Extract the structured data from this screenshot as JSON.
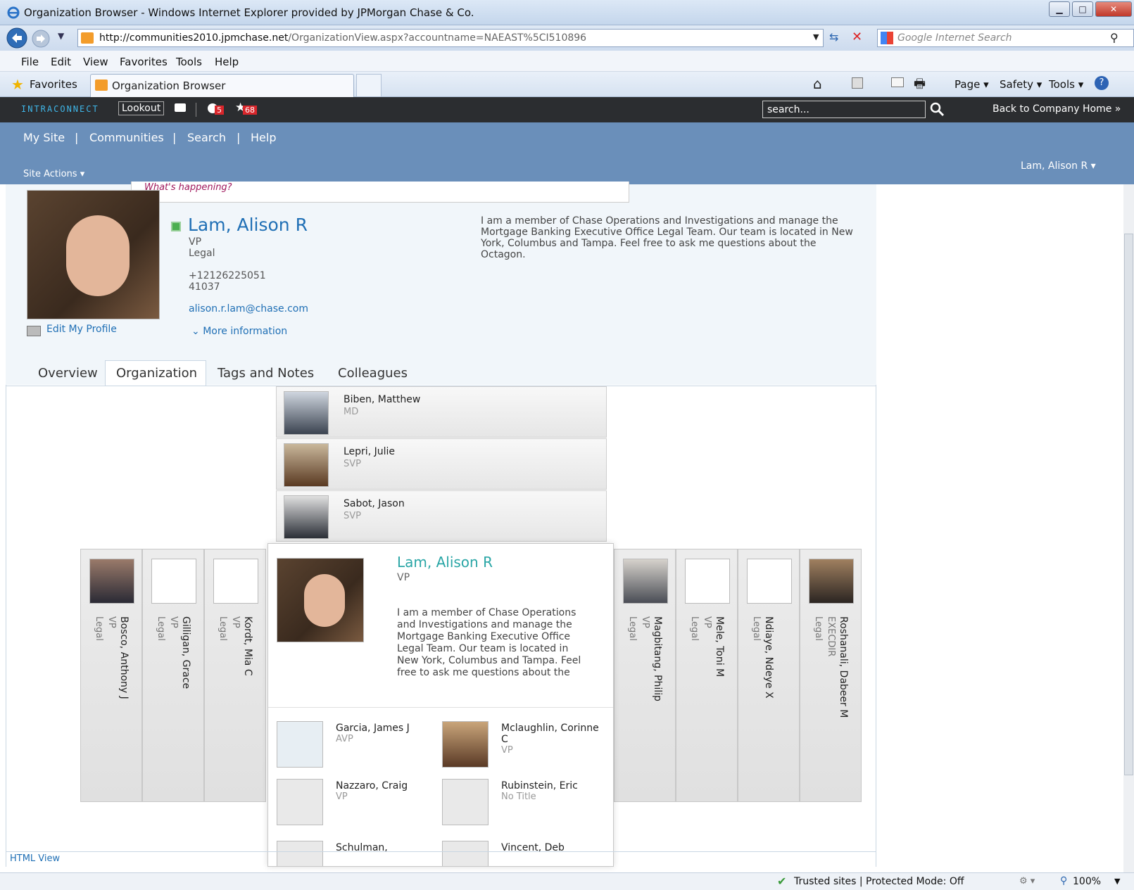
{
  "window": {
    "title": "Organization Browser - Windows Internet Explorer provided by JPMorgan Chase & Co."
  },
  "address": {
    "url_domain": "http://communities2010.jpmchase.net",
    "url_path": "/OrganizationView.aspx?accountname=NAEAST%5CI510896",
    "search_placeholder": "Google Internet Search"
  },
  "menu": [
    "File",
    "Edit",
    "View",
    "Favorites",
    "Tools",
    "Help"
  ],
  "favbar": {
    "favorites": "Favorites",
    "tab_title": "Organization Browser",
    "tools": [
      "Page ▾",
      "Safety ▾",
      "Tools ▾"
    ]
  },
  "intraconnect": {
    "logo": "INTRACONNECT",
    "lookout": "Lookout",
    "badge1": "5",
    "badge2": "68",
    "search_placeholder": "search...",
    "back": "Back to Company Home »"
  },
  "nav": {
    "links": [
      "My Site",
      "Communities",
      "Search",
      "Help"
    ],
    "site_actions": "Site Actions ▾",
    "user": "Lam, Alison R ▾"
  },
  "profile": {
    "status_prompt": "What's happening?",
    "name": "Lam, Alison R",
    "title": "VP",
    "dept": "Legal",
    "phone": "+12126225051",
    "ext": "41037",
    "email": "alison.r.lam@chase.com",
    "edit": "Edit My Profile",
    "more": "More information",
    "about": "I am a member of Chase Operations and Investigations and manage the Mortgage Banking Executive Office Legal Team. Our team is located in New York, Columbus and Tampa. Feel free to ask me questions about the Octagon."
  },
  "tabs": [
    "Overview",
    "Organization",
    "Tags and Notes",
    "Colleagues"
  ],
  "managers": [
    {
      "name": "Biben, Matthew",
      "title": "MD"
    },
    {
      "name": "Lepri, Julie",
      "title": "SVP"
    },
    {
      "name": "Sabot, Jason",
      "title": "SVP"
    }
  ],
  "peers_left": [
    {
      "name": "Bosco, Anthony J",
      "title": "VP",
      "dept": "Legal"
    },
    {
      "name": "Gilligan, Grace",
      "title": "VP",
      "dept": "Legal"
    },
    {
      "name": "Kordt, Mia C",
      "title": "VP",
      "dept": "Legal"
    }
  ],
  "peers_right": [
    {
      "name": "Magbitang, Philip",
      "title": "VP",
      "dept": "Legal"
    },
    {
      "name": "Mele, Toni M",
      "title": "VP",
      "dept": "Legal"
    },
    {
      "name": "Ndiaye, Ndeye X",
      "title": "",
      "dept": "Legal"
    },
    {
      "name": "Roshanali, Dabeer M",
      "title": "EXECDIR",
      "dept": "Legal"
    }
  ],
  "center": {
    "name": "Lam, Alison R",
    "title": "VP",
    "about": "I am a member of Chase Operations and Investigations and manage the Mortgage Banking Executive Office Legal Team. Our team is located in New York, Columbus and Tampa. Feel free to ask me questions about the"
  },
  "reports": [
    {
      "name": "Garcia, James J",
      "title": "AVP"
    },
    {
      "name": "Mclaughlin, Corinne C",
      "title": "VP"
    },
    {
      "name": "Nazzaro, Craig",
      "title": "VP"
    },
    {
      "name": "Rubinstein, Eric",
      "title": "No Title"
    },
    {
      "name": "Schulman,",
      "title": ""
    },
    {
      "name": "Vincent, Deb",
      "title": ""
    }
  ],
  "footer": {
    "html_view": "HTML View"
  },
  "status": {
    "zone": "Trusted sites | Protected Mode: Off",
    "zoom": "100%"
  },
  "colors": {
    "nav_blue": "#6a8fba",
    "link_blue": "#1f6fb5",
    "teal_name": "#2aa6a6",
    "status_green": "#4caf50"
  }
}
